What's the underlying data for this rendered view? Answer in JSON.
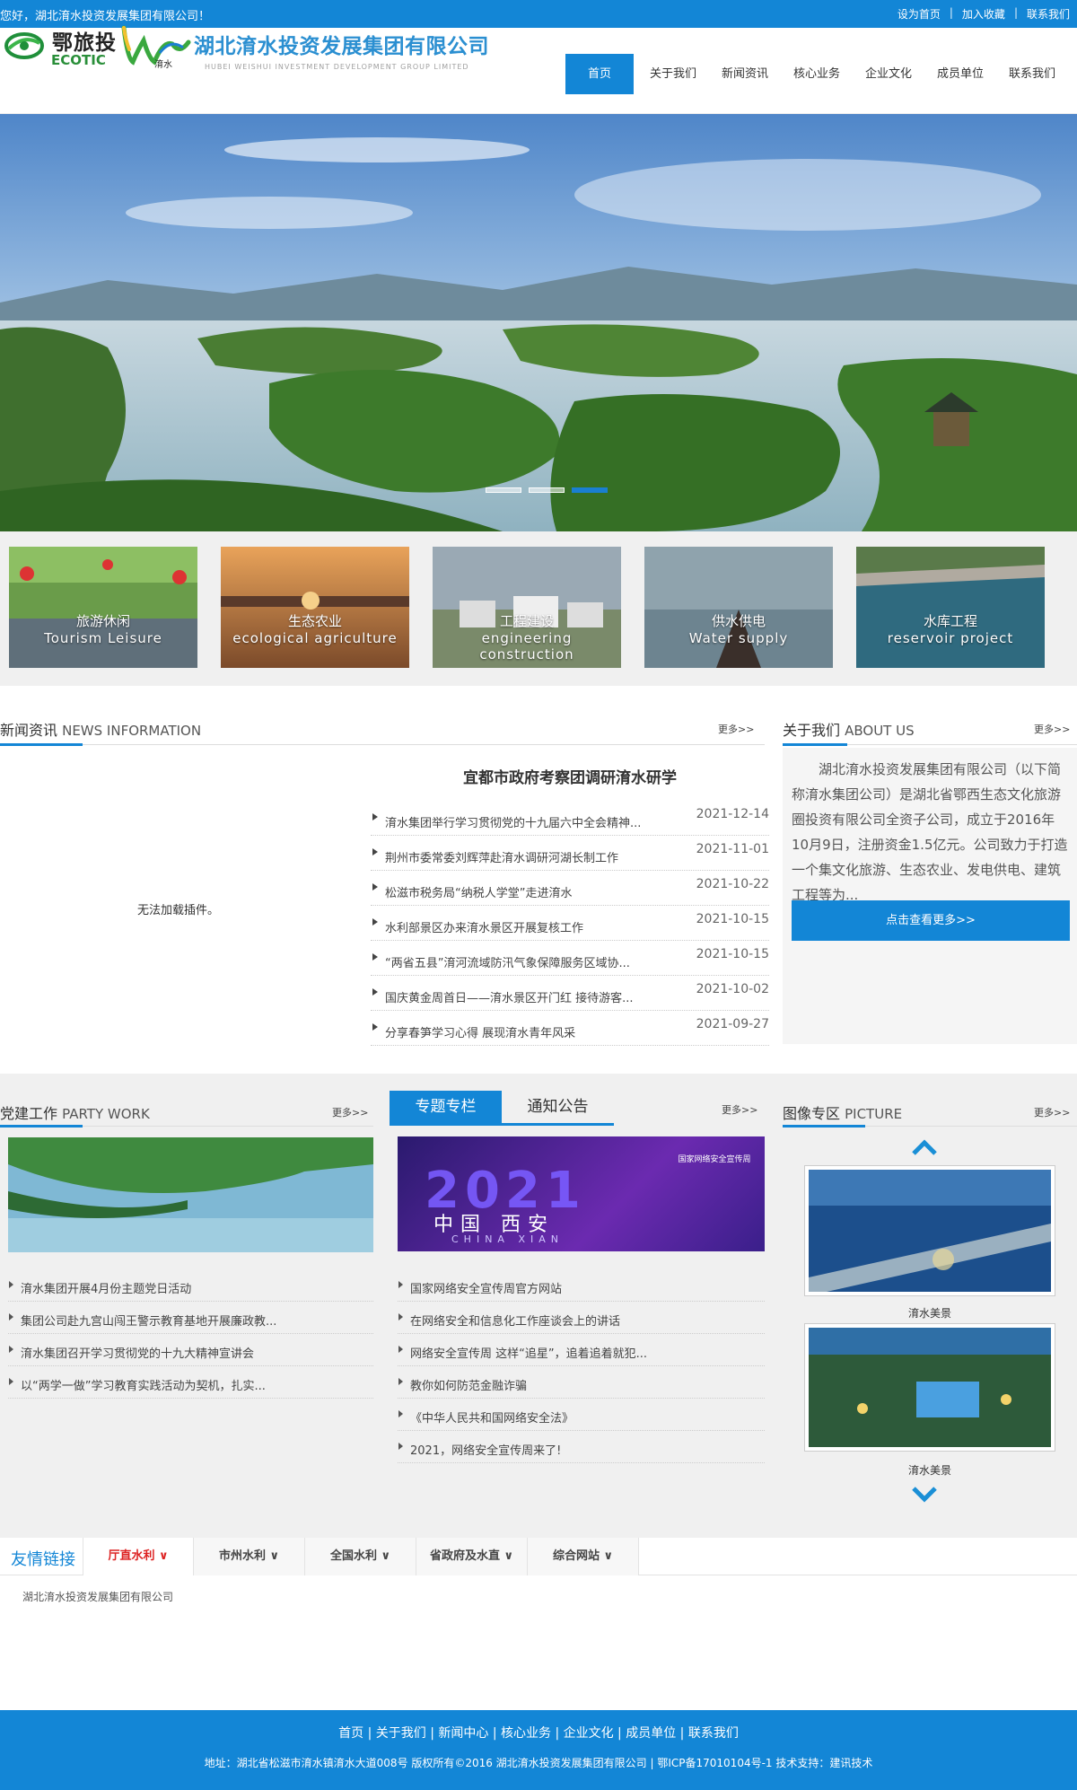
{
  "topbar": {
    "welcome": "您好，湖北淯水投资发展集团有限公司！",
    "links": [
      "设为首页",
      "加入收藏",
      "联系我们"
    ]
  },
  "header": {
    "logo_cn": "鄂旅投",
    "logo_en": "ECOTIC",
    "company_name": "湖北淯水投资发展集团有限公司",
    "company_en": "HUBEI WEISHUI INVESTMENT DEVELOPMENT GROUP LIMITED"
  },
  "nav": [
    "首页",
    "关于我们",
    "新闻资讯",
    "核心业务",
    "企业文化",
    "成员单位",
    "联系我们"
  ],
  "tiles": [
    {
      "cn": "旅游休闲",
      "en": "Tourism Leisure"
    },
    {
      "cn": "生态农业",
      "en": "ecological agriculture"
    },
    {
      "cn": "工程建设",
      "en": "engineering construction"
    },
    {
      "cn": "供水供电",
      "en": "Water supply"
    },
    {
      "cn": "水库工程",
      "en": "reservoir project"
    }
  ],
  "news": {
    "title_cn": "新闻资讯",
    "title_en": "NEWS INFORMATION",
    "more": "更多>>",
    "no_plugin": "无法加载插件。",
    "headline": "宜都市政府考察团调研淯水研学",
    "items": [
      {
        "title": "淯水集团举行学习贯彻党的十九届六中全会精神...",
        "date": "2021-12-14"
      },
      {
        "title": "荆州市委常委刘辉萍赴淯水调研河湖长制工作",
        "date": "2021-11-01"
      },
      {
        "title": "松滋市税务局“纳税人学堂”走进淯水",
        "date": "2021-10-22"
      },
      {
        "title": "水利部景区办来淯水景区开展复核工作",
        "date": "2021-10-15"
      },
      {
        "title": "“两省五县”淯河流域防汛气象保障服务区域协...",
        "date": "2021-10-15"
      },
      {
        "title": "国庆黄金周首日——淯水景区开门红 接待游客...",
        "date": "2021-10-02"
      },
      {
        "title": "分享春笋学习心得 展现淯水青年风采",
        "date": "2021-09-27"
      }
    ]
  },
  "about": {
    "title_cn": "关于我们",
    "title_en": "ABOUT US",
    "more": "更多>>",
    "text": "湖北淯水投资发展集团有限公司（以下简称淯水集团公司）是湖北省鄂西生态文化旅游圈投资有限公司全资子公司，成立于2016年10月9日，注册资金1.5亿元。公司致力于打造一个集文化旅游、生态农业、发电供电、建筑工程等为...",
    "button": "点击查看更多>>"
  },
  "party": {
    "title_cn": "党建工作",
    "title_en": "PARTY WORK",
    "more": "更多>>",
    "items": [
      "淯水集团开展4月份主题党日活动",
      "集团公司赴九宫山闯王警示教育基地开展廉政教...",
      "淯水集团召开学习贯彻党的十九大精神宣讲会",
      "以“两学一做”学习教育实践活动为契机，扎实..."
    ]
  },
  "special": {
    "tab_on": "专题专栏",
    "tab_off": "通知公告",
    "more": "更多>>",
    "poster_year": "2021",
    "poster_city": "中国 西安",
    "poster_city_en": "CHINA XIAN",
    "poster_badge": "国家网络安全宣传周",
    "items": [
      "国家网络安全宣传周官方网站",
      "在网络安全和信息化工作座谈会上的讲话",
      "网络安全宣传周 这样“追星”，追着追着就犯...",
      "教你如何防范金融诈骗",
      "《中华人民共和国网络安全法》",
      "2021，网络安全宣传周来了!"
    ]
  },
  "pictures": {
    "title_cn": "图像专区",
    "title_en": "PICTURE",
    "more": "更多>>",
    "items": [
      {
        "caption": "淯水美景"
      },
      {
        "caption": "淯水美景"
      }
    ]
  },
  "links": {
    "title": "友情链接",
    "tabs": [
      "厅直水利",
      "市州水利",
      "全国水利",
      "省政府及水直",
      "综合网站"
    ],
    "item": "湖北淯水投资发展集团有限公司"
  },
  "footer": {
    "nav": "首页 | 关于我们 | 新闻中心 | 核心业务 | 企业文化 | 成员单位 | 联系我们",
    "info": "地址：湖北省松滋市淯水镇淯水大道008号 版权所有©2016 湖北淯水投资发展集团有限公司 | 鄂ICP备17010104号-1 技术支持：建讯技术"
  },
  "colors": {
    "brand_blue": "#1386d6",
    "active_tab_red": "#dd2222"
  }
}
